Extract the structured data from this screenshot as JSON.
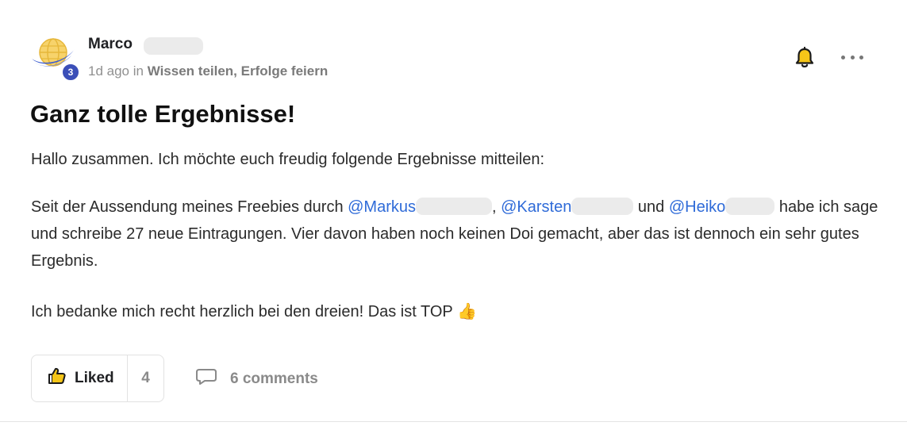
{
  "author": {
    "name": "Marco",
    "level": "3"
  },
  "meta": {
    "time": "1d ago in ",
    "group": "Wissen teilen, Erfolge feiern"
  },
  "post": {
    "title": "Ganz tolle Ergebnisse!",
    "p1": "Hallo zusammen. Ich möchte euch freudig folgende Ergebnisse mitteilen:",
    "p2_a": "Seit der Aussendung meines Freebies durch ",
    "mention_1": "@Markus",
    "p2_b": ", ",
    "mention_2": "@Karsten",
    "p2_c": " und ",
    "mention_3": "@Heiko",
    "p2_d": " habe ich sage und schreibe 27 neue Eintragungen. Vier davon haben noch keinen Doi gemacht, aber das ist dennoch ein sehr gutes Ergebnis.",
    "p3": "Ich bedanke mich recht herzlich bei den dreien! Das ist TOP ",
    "emoji": "👍"
  },
  "actions": {
    "like_label": "Liked",
    "like_count": "4",
    "comments_label": "6 comments"
  },
  "icons": {
    "bell": "bell-icon",
    "more": "more-options-icon",
    "like": "thumbs-up-icon",
    "comment": "comment-icon"
  },
  "colors": {
    "mention": "#2f6bd8",
    "level_badge": "#3b4fb8",
    "bell": "#f5c518"
  }
}
